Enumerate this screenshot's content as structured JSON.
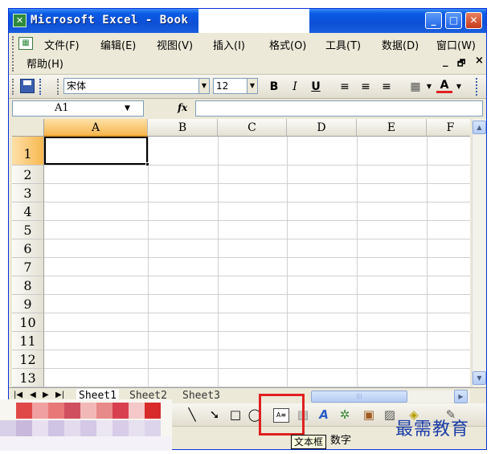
{
  "window": {
    "title": "Microsoft Excel - Book",
    "controls": {
      "minimize": "_",
      "maximize": "□",
      "close": "✕"
    }
  },
  "menu": {
    "items": [
      "文件(F)",
      "编辑(E)",
      "视图(V)",
      "插入(I)",
      "格式(O)",
      "工具(T)",
      "数据(D)",
      "窗口(W)",
      "帮助(H)"
    ],
    "doc_controls": {
      "minimize": "_",
      "restore": "🗗",
      "close": "×"
    }
  },
  "format_toolbar": {
    "font_name": "宋体",
    "font_size": "12",
    "bold": "B",
    "italic": "I",
    "underline": "U",
    "align_left": "≡",
    "align_center": "≡",
    "align_right": "≡",
    "font_color_label": "A",
    "font_color": "#e02020"
  },
  "formula_bar": {
    "name_box": "A1",
    "fx": "fx",
    "formula": ""
  },
  "sheet": {
    "columns": [
      "A",
      "B",
      "C",
      "D",
      "E",
      "F"
    ],
    "rows": [
      "1",
      "2",
      "3",
      "4",
      "5",
      "6",
      "7",
      "8",
      "9",
      "10",
      "11",
      "12",
      "13"
    ],
    "active_cell": "A1",
    "active_column": "A",
    "active_row": "1"
  },
  "tabs": {
    "nav": [
      "|◀",
      "◀",
      "▶",
      "▶|"
    ],
    "sheets": [
      "Sheet1",
      "Sheet2",
      "Sheet3"
    ],
    "active": "Sheet1"
  },
  "draw_toolbar": {
    "tools": [
      "line-tool",
      "arrow-tool",
      "rectangle-tool",
      "oval-tool",
      "text-box-tool",
      "vertical-text-box-tool",
      "wordart-tool",
      "diagram-tool",
      "clipart-tool",
      "picture-tool",
      "fill-color-tool",
      "line-color-tool"
    ],
    "highlighted": "text-box-tool"
  },
  "status": {
    "mode_text": "数字"
  },
  "tooltip": {
    "text": "文本框"
  },
  "watermark": {
    "text": "最需教育"
  },
  "colors": {
    "titlebar": "#0d50d6",
    "highlight": "#e02020",
    "active_header": "#f8b850",
    "watermark": "#1a3ca8"
  }
}
